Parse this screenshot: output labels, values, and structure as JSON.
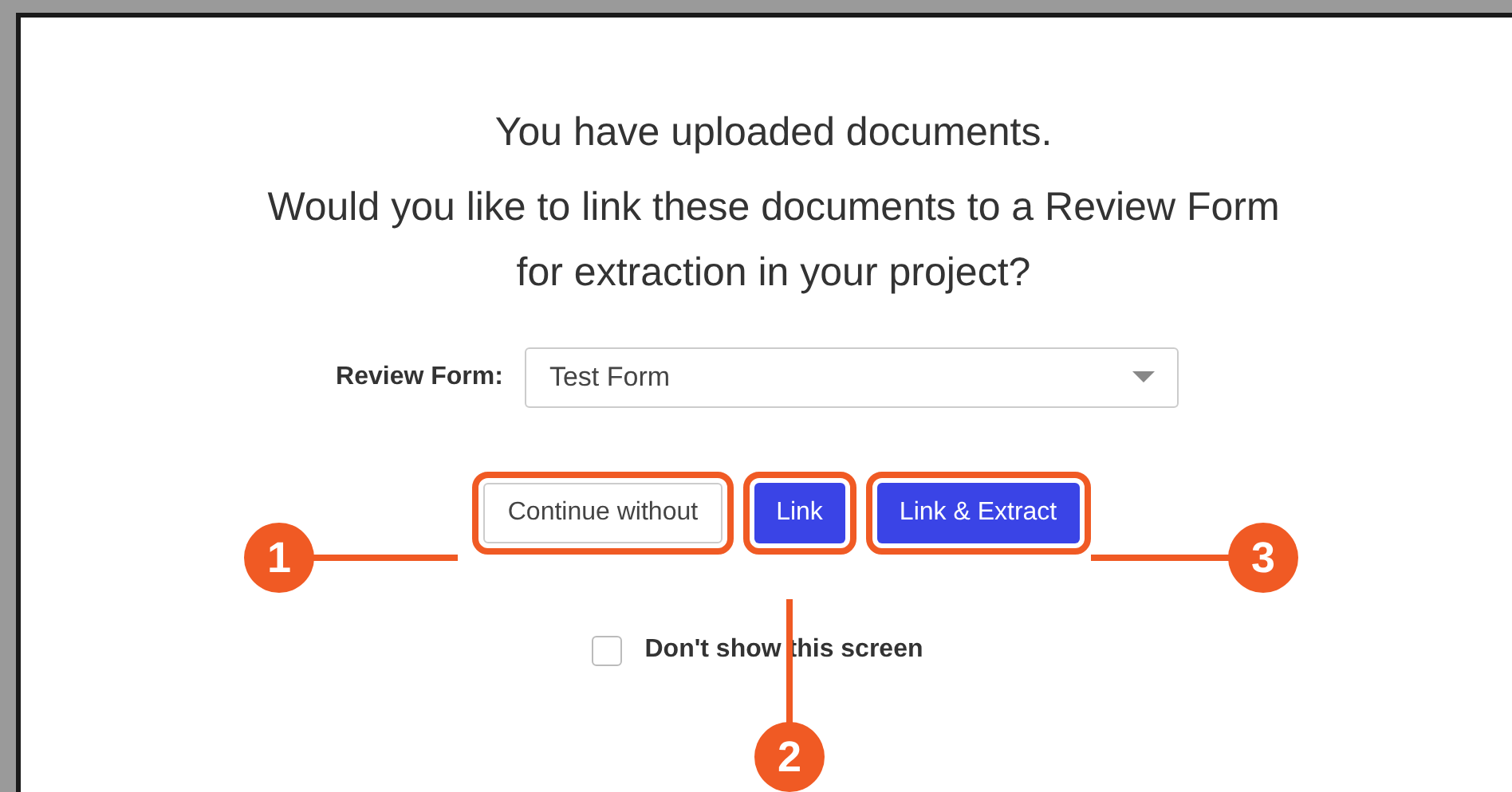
{
  "dialog": {
    "heading_lines": [
      "You have uploaded documents.",
      "Would you like to link these documents to a Review Form for extraction in your project?"
    ],
    "review_form": {
      "label": "Review Form:",
      "value": "Test Form"
    },
    "buttons": [
      {
        "label": "Continue without",
        "kind": "secondary",
        "callout": "1"
      },
      {
        "label": "Link",
        "kind": "primary",
        "callout": "2"
      },
      {
        "label": "Link & Extract",
        "kind": "primary",
        "callout": "3"
      }
    ],
    "checkbox": {
      "label": "Don't show this screen",
      "checked": false
    }
  }
}
